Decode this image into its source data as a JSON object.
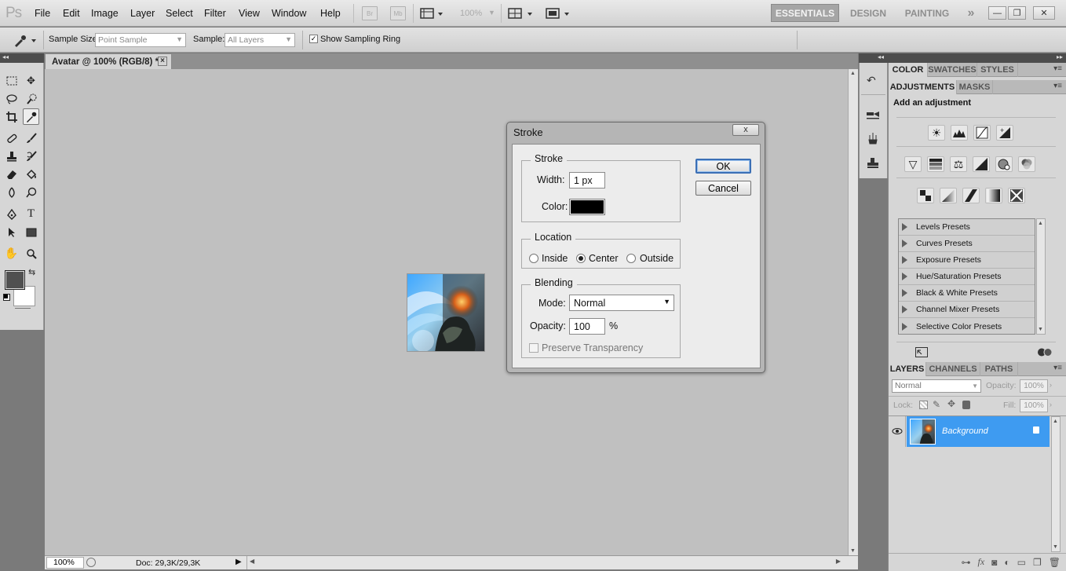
{
  "app": {
    "logo": "Ps"
  },
  "menu": [
    "File",
    "Edit",
    "Image",
    "Layer",
    "Select",
    "Filter",
    "View",
    "Window",
    "Help"
  ],
  "menubar": {
    "br_label": "Br",
    "mb_label": "Mb",
    "zoom": "100%"
  },
  "workspaces": {
    "essentials": "ESSENTIALS",
    "design": "DESIGN",
    "painting": "PAINTING",
    "more": "»"
  },
  "options": {
    "sample_size_label": "Sample Size:",
    "sample_size_value": "Point Sample",
    "sample_label": "Sample:",
    "sample_value": "All Layers",
    "show_ring_label": "Show Sampling Ring",
    "show_ring_checked": true
  },
  "document": {
    "tab_title": "Avatar @ 100% (RGB/8) *",
    "close": "×"
  },
  "status": {
    "zoom": "100%",
    "doc": "Doc: 29,3K/29,3K"
  },
  "color_panel": {
    "tabs": [
      "COLOR",
      "SWATCHES",
      "STYLES"
    ]
  },
  "adjustments_panel": {
    "tabs": [
      "ADJUSTMENTS",
      "MASKS"
    ],
    "title": "Add an adjustment",
    "presets": [
      "Levels Presets",
      "Curves Presets",
      "Exposure Presets",
      "Hue/Saturation Presets",
      "Black & White Presets",
      "Channel Mixer Presets",
      "Selective Color Presets"
    ]
  },
  "layers_panel": {
    "tabs": [
      "LAYERS",
      "CHANNELS",
      "PATHS"
    ],
    "blend_mode": "Normal",
    "opacity_label": "Opacity:",
    "opacity_value": "100%",
    "lock_label": "Lock:",
    "fill_label": "Fill:",
    "fill_value": "100%",
    "layer_name": "Background"
  },
  "stroke_dialog": {
    "title": "Stroke",
    "close": "x",
    "stroke_group": "Stroke",
    "width_label": "Width:",
    "width_value": "1 px",
    "color_label": "Color:",
    "color_value": "#000000",
    "location_group": "Location",
    "location_options": [
      "Inside",
      "Center",
      "Outside"
    ],
    "location_selected": "Center",
    "blending_group": "Blending",
    "mode_label": "Mode:",
    "mode_value": "Normal",
    "opacity_label": "Opacity:",
    "opacity_value": "100",
    "opacity_unit": "%",
    "preserve_label": "Preserve Transparency",
    "ok": "OK",
    "cancel": "Cancel"
  },
  "colors": {
    "selection": "#3e9bf1",
    "canvas": "#c0c0c0",
    "foreground": "#505050",
    "background": "#ffffff"
  }
}
